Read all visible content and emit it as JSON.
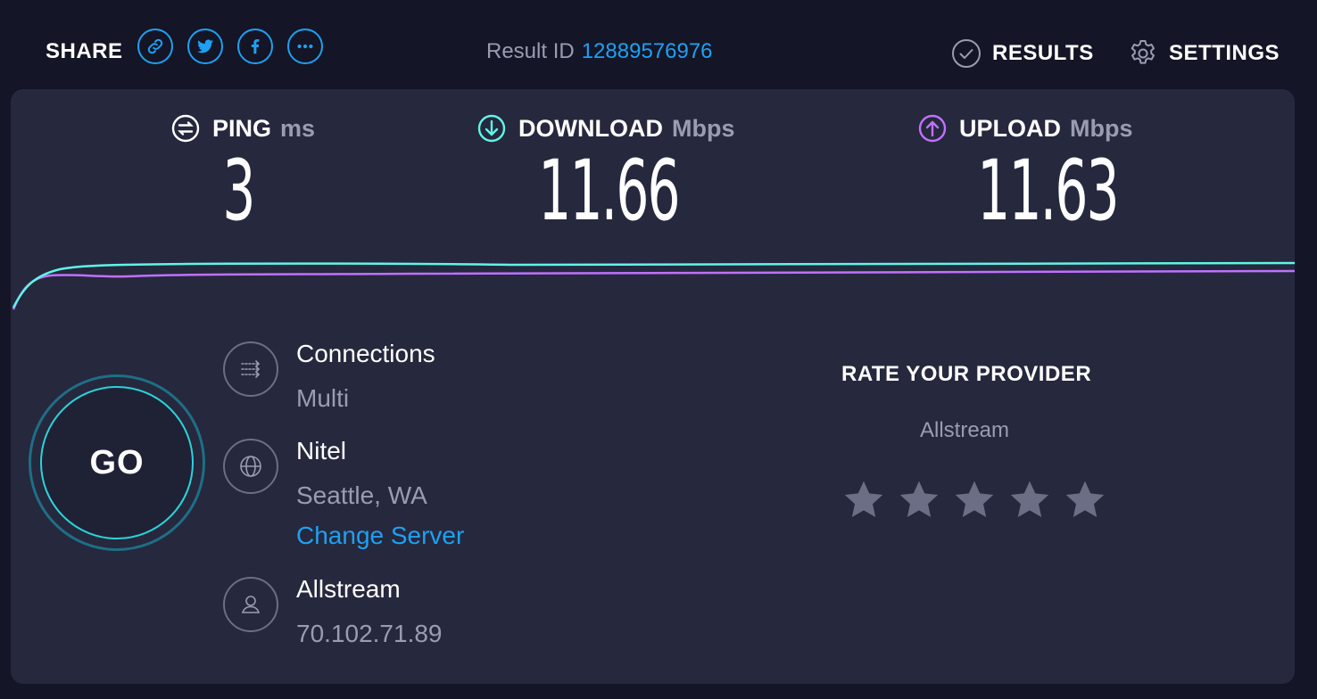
{
  "header": {
    "share_label": "SHARE",
    "share_buttons": [
      {
        "name": "link-icon"
      },
      {
        "name": "twitter-icon"
      },
      {
        "name": "facebook-icon"
      },
      {
        "name": "more-icon"
      }
    ],
    "result_id_label": "Result ID",
    "result_id_value": "12889576976",
    "results_label": "RESULTS",
    "settings_label": "SETTINGS"
  },
  "metrics": {
    "ping": {
      "label": "PING",
      "unit": "ms",
      "value": "3",
      "icon": "ping-icon"
    },
    "download": {
      "label": "DOWNLOAD",
      "unit": "Mbps",
      "value": "11.66",
      "icon": "download-arrow-icon",
      "color": "#5ff5e8"
    },
    "upload": {
      "label": "UPLOAD",
      "unit": "Mbps",
      "value": "11.63",
      "icon": "upload-arrow-icon",
      "color": "#bf71ff"
    }
  },
  "go_button": {
    "label": "GO"
  },
  "connections": {
    "title": "Connections",
    "value": "Multi",
    "icon": "connections-icon"
  },
  "server": {
    "name": "Nitel",
    "location": "Seattle, WA",
    "change_label": "Change Server",
    "icon": "globe-icon"
  },
  "isp": {
    "name": "Allstream",
    "ip": "70.102.71.89",
    "icon": "user-icon"
  },
  "rating": {
    "title": "RATE YOUR PROVIDER",
    "provider": "Allstream",
    "stars": 5
  },
  "colors": {
    "background": "#141526",
    "panel": "#26283d",
    "accent_blue": "#1da1f2",
    "download_line": "#5ff5e8",
    "upload_line": "#bf71ff",
    "muted_text": "#9a9cb1"
  }
}
